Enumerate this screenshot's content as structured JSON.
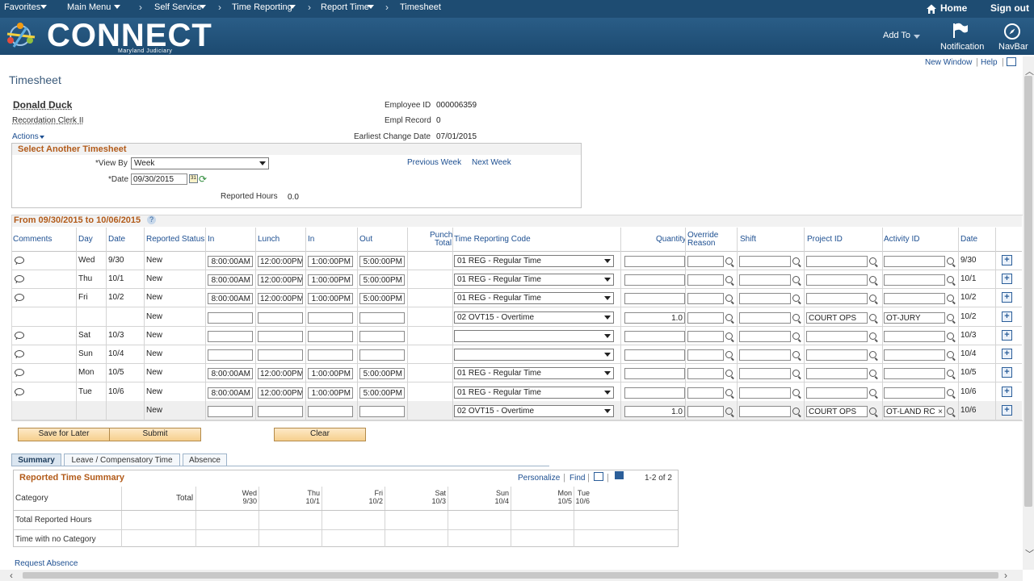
{
  "topnav": {
    "favorites": "Favorites",
    "main_menu": "Main Menu",
    "self_service": "Self Service",
    "time_reporting": "Time Reporting",
    "report_time": "Report Time",
    "timesheet": "Timesheet",
    "home": "Home",
    "sign_out": "Sign out"
  },
  "banner": {
    "logo_word": "CONNECT",
    "logo_sub": "Maryland Judiciary",
    "add_to": "Add To",
    "notification": "Notification",
    "navbar": "NavBar"
  },
  "links": {
    "new_window": "New Window",
    "help": "Help"
  },
  "page_title": "Timesheet",
  "employee": {
    "name": "Donald Duck",
    "title": "Recordation Clerk II",
    "actions": "Actions",
    "employee_id_label": "Employee ID",
    "employee_id": "000006359",
    "empl_record_label": "Empl Record",
    "empl_record": "0",
    "earliest_change_label": "Earliest Change Date",
    "earliest_change": "07/01/2015"
  },
  "select_timesheet": {
    "title": "Select Another Timesheet",
    "view_by_label": "*View By",
    "view_by": "Week",
    "date_label": "*Date",
    "date": "09/30/2015",
    "previous_week": "Previous Week",
    "next_week": "Next Week",
    "reported_hours_label": "Reported Hours",
    "reported_hours": "0.0"
  },
  "grid": {
    "title": "From 09/30/2015 to 10/06/2015",
    "headers": {
      "comments": "Comments",
      "day": "Day",
      "date": "Date",
      "status": "Reported Status",
      "in1": "In",
      "lunch": "Lunch",
      "in2": "In",
      "out": "Out",
      "punch1": "Punch",
      "punch2": "Total",
      "trc": "Time Reporting Code",
      "quantity": "Quantity",
      "override1": "Override",
      "override2": "Reason",
      "shift": "Shift",
      "project": "Project ID",
      "activity": "Activity ID",
      "date2": "Date"
    },
    "rows": [
      {
        "comment": true,
        "day": "Wed",
        "date": "9/30",
        "status": "New",
        "in": "8:00:00AM",
        "lunch": "12:00:00PM",
        "in2": "1:00:00PM",
        "out": "5:00:00PM",
        "trc": "01 REG - Regular Time",
        "qty": "",
        "project": "",
        "activity": "",
        "date2": "9/30"
      },
      {
        "comment": true,
        "day": "Thu",
        "date": "10/1",
        "status": "New",
        "in": "8:00:00AM",
        "lunch": "12:00:00PM",
        "in2": "1:00:00PM",
        "out": "5:00:00PM",
        "trc": "01 REG - Regular Time",
        "qty": "",
        "project": "",
        "activity": "",
        "date2": "10/1"
      },
      {
        "comment": true,
        "day": "Fri",
        "date": "10/2",
        "status": "New",
        "in": "8:00:00AM",
        "lunch": "12:00:00PM",
        "in2": "1:00:00PM",
        "out": "5:00:00PM",
        "trc": "01 REG - Regular Time",
        "qty": "",
        "project": "",
        "activity": "",
        "date2": "10/2"
      },
      {
        "comment": false,
        "day": "",
        "date": "",
        "status": "New",
        "in": "",
        "lunch": "",
        "in2": "",
        "out": "",
        "trc": "02 OVT15 - Overtime",
        "qty": "1.0",
        "project": "COURT OPS",
        "activity": "OT-JURY",
        "date2": "10/2"
      },
      {
        "comment": true,
        "day": "Sat",
        "date": "10/3",
        "status": "New",
        "in": "",
        "lunch": "",
        "in2": "",
        "out": "",
        "trc": "",
        "qty": "",
        "project": "",
        "activity": "",
        "date2": "10/3"
      },
      {
        "comment": true,
        "day": "Sun",
        "date": "10/4",
        "status": "New",
        "in": "",
        "lunch": "",
        "in2": "",
        "out": "",
        "trc": "",
        "qty": "",
        "project": "",
        "activity": "",
        "date2": "10/4"
      },
      {
        "comment": true,
        "day": "Mon",
        "date": "10/5",
        "status": "New",
        "in": "8:00:00AM",
        "lunch": "12:00:00PM",
        "in2": "1:00:00PM",
        "out": "5:00:00PM",
        "trc": "01 REG - Regular Time",
        "qty": "",
        "project": "",
        "activity": "",
        "date2": "10/5"
      },
      {
        "comment": true,
        "day": "Tue",
        "date": "10/6",
        "status": "New",
        "in": "8:00:00AM",
        "lunch": "12:00:00PM",
        "in2": "1:00:00PM",
        "out": "5:00:00PM",
        "trc": "01 REG - Regular Time",
        "qty": "",
        "project": "",
        "activity": "",
        "date2": "10/6"
      },
      {
        "comment": false,
        "day": "",
        "date": "",
        "status": "New",
        "in": "",
        "lunch": "",
        "in2": "",
        "out": "",
        "trc": "02 OVT15 - Overtime",
        "qty": "1.0",
        "project": "COURT OPS",
        "activity": "OT-LAND RC",
        "date2": "10/6"
      }
    ]
  },
  "buttons": {
    "save_for_later": "Save for Later",
    "submit": "Submit",
    "clear": "Clear"
  },
  "tabs": [
    "Summary",
    "Leave / Compensatory Time",
    "Absence"
  ],
  "summary": {
    "title": "Reported Time Summary",
    "personalize": "Personalize",
    "find": "Find",
    "count": "1-2 of 2",
    "category_header": "Category",
    "total_header": "Total",
    "days": [
      {
        "day": "Wed",
        "date": "9/30"
      },
      {
        "day": "Thu",
        "date": "10/1"
      },
      {
        "day": "Fri",
        "date": "10/2"
      },
      {
        "day": "Sat",
        "date": "10/3"
      },
      {
        "day": "Sun",
        "date": "10/4"
      },
      {
        "day": "Mon",
        "date": "10/5"
      },
      {
        "day": "Tue",
        "date": "10/6"
      }
    ],
    "rows": [
      "Total Reported Hours",
      "Time with no Category"
    ]
  },
  "request_absence": "Request Absence"
}
